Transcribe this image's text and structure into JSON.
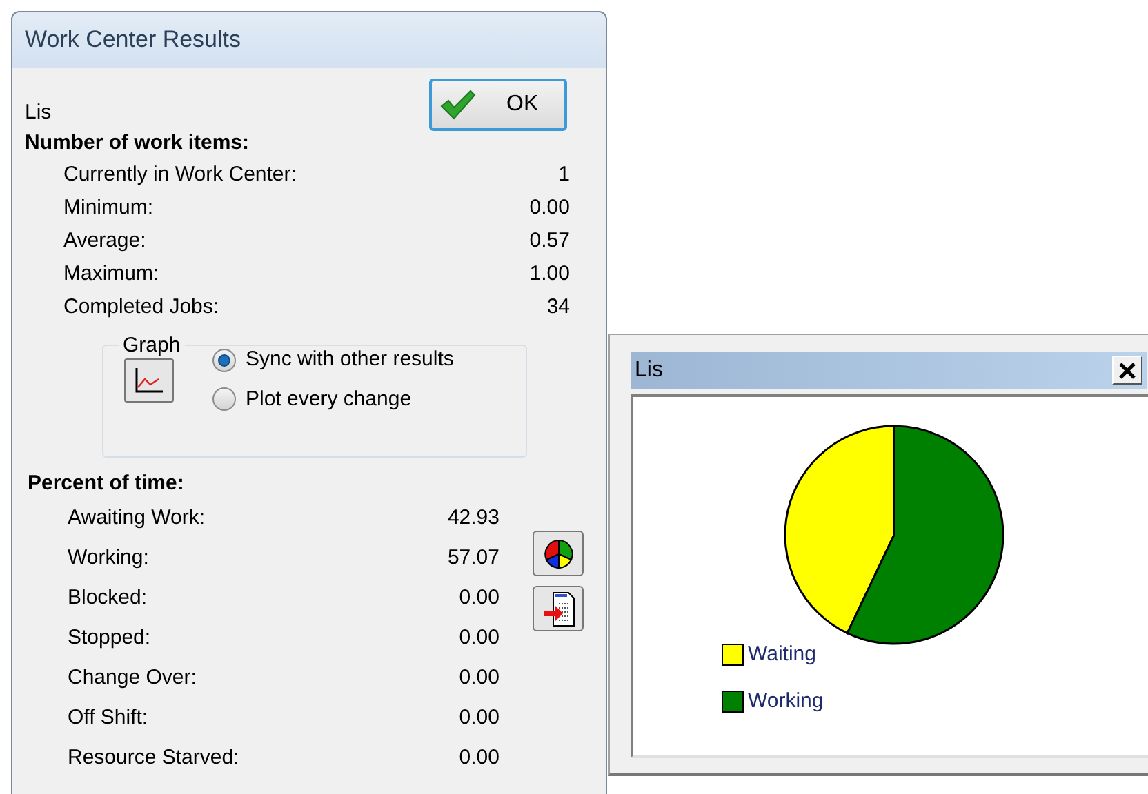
{
  "dialog": {
    "title": "Work Center Results",
    "name": "Lis",
    "ok_button": "OK",
    "work_items": {
      "heading": "Number of work items:",
      "rows": [
        {
          "label": "Currently in Work Center:",
          "value": "1"
        },
        {
          "label": "Minimum:",
          "value": "0.00"
        },
        {
          "label": "Average:",
          "value": "0.57"
        },
        {
          "label": "Maximum:",
          "value": "1.00"
        },
        {
          "label": "Completed Jobs:",
          "value": "34"
        }
      ]
    },
    "graph": {
      "legend": "Graph",
      "options": [
        {
          "label": "Sync with other results",
          "selected": true
        },
        {
          "label": "Plot every change",
          "selected": false
        }
      ]
    },
    "percent_of_time": {
      "heading": "Percent of time:",
      "rows": [
        {
          "label": "Awaiting Work:",
          "value": "42.93"
        },
        {
          "label": "Working:",
          "value": "57.07"
        },
        {
          "label": "Blocked:",
          "value": "0.00"
        },
        {
          "label": "Stopped:",
          "value": "0.00"
        },
        {
          "label": "Change Over:",
          "value": "0.00"
        },
        {
          "label": "Off Shift:",
          "value": "0.00"
        },
        {
          "label": "Resource Starved:",
          "value": "0.00"
        }
      ]
    }
  },
  "chart_window": {
    "title": "Lis",
    "chart_data": {
      "type": "pie",
      "legend": "bottom-left",
      "categories": [
        "Waiting",
        "Working"
      ],
      "colors": [
        "#ffff00",
        "#008000"
      ],
      "values": [
        42.93,
        57.07
      ]
    }
  }
}
